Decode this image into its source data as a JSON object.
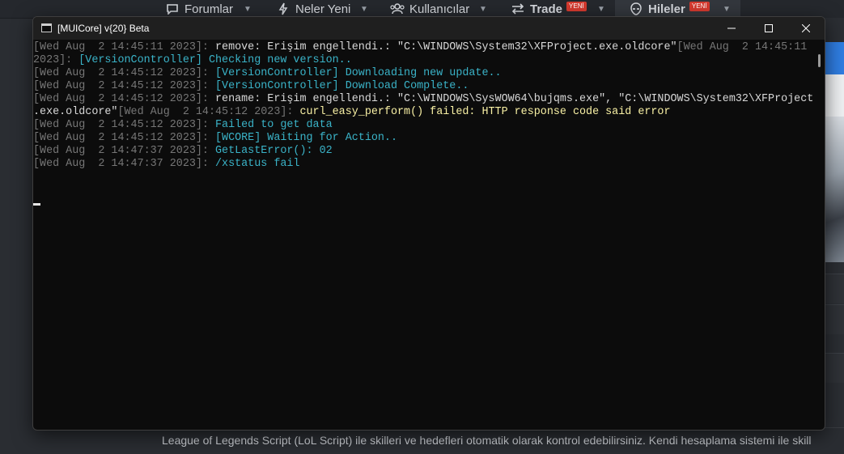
{
  "navbar": {
    "items": [
      {
        "label": "Forumlar",
        "icon": "speech-bubble-icon"
      },
      {
        "label": "Neler Yeni",
        "icon": "lightning-icon"
      },
      {
        "label": "Kullanıcılar",
        "icon": "users-icon"
      },
      {
        "label": "Trade",
        "icon": "swap-arrows-icon",
        "badge": "YENİ"
      },
      {
        "label": "Hileler",
        "icon": "alien-icon",
        "badge": "YENİ"
      }
    ]
  },
  "window": {
    "title": "[MUICore] v{20} Beta"
  },
  "console": {
    "lines": [
      {
        "ts": "[Wed Aug  2 14:45:11 2023]: ",
        "msg": "remove: Erişim engellendi.: \"C:\\WINDOWS\\System32\\XFProject.exe.oldcore\"",
        "ts2": "[Wed Aug  2 14:45:11"
      },
      {
        "ts": "2023]: ",
        "msg": "[VersionController] Checking new version.."
      },
      {
        "ts": "[Wed Aug  2 14:45:12 2023]: ",
        "msg": "[VersionController] Downloading new update.."
      },
      {
        "ts": "[Wed Aug  2 14:45:12 2023]: ",
        "msg": "[VersionController] Download Complete.."
      },
      {
        "ts": "[Wed Aug  2 14:45:12 2023]: ",
        "msg": "rename: Erişim engellendi.: \"C:\\WINDOWS\\SysWOW64\\bujqms.exe\", \"C:\\WINDOWS\\System32\\XFProject"
      },
      {
        "msg": ".exe.oldcore\"",
        "ts": "[Wed Aug  2 14:45:12 2023]: ",
        "msg2": "curl_easy_perform() failed: HTTP response code said error"
      },
      {
        "ts": "[Wed Aug  2 14:45:12 2023]: ",
        "msg": "Failed to get data"
      },
      {
        "ts": "[Wed Aug  2 14:45:12 2023]: ",
        "msg": "[WCORE] Waiting for Action.."
      },
      {
        "ts": "[Wed Aug  2 14:47:37 2023]: ",
        "msg": "GetLastError(): 02"
      },
      {
        "ts": "[Wed Aug  2 14:47:37 2023]: ",
        "msg": "/xstatus fail"
      }
    ]
  },
  "background": {
    "bottom_text": "League of Legends Script (LoL Script) ile skilleri ve hedefleri otomatik olarak kontrol edebilirsiniz. Kendi hesaplama sistemi ile skill"
  },
  "colors": {
    "console_bg": "#0c0c0c",
    "timestamp": "#767676",
    "message_cyan": "#3ab3c8",
    "message_yellow": "#f9f1a5",
    "badge_red": "#d63a2f"
  }
}
